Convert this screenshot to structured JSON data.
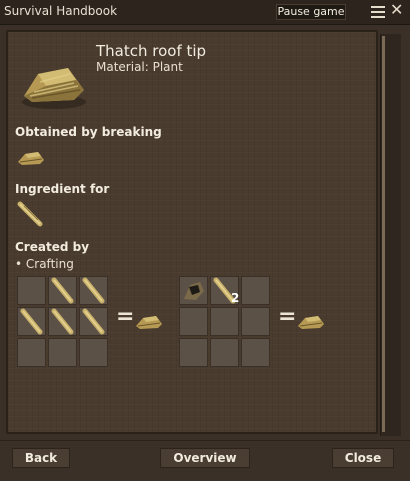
{
  "window": {
    "title": "Survival Handbook",
    "pause_label": "Pause game"
  },
  "item": {
    "name": "Thatch roof tip",
    "material": "Material: Plant",
    "icon": "thatch-roof-tip-icon"
  },
  "sections": {
    "obtained": "Obtained by breaking",
    "ingredient": "Ingredient for",
    "created": "Created by",
    "crafting": "• Crafting"
  },
  "recipes": [
    {
      "grid": [
        "",
        "straw",
        "straw",
        "straw",
        "straw",
        "straw",
        "",
        "",
        ""
      ],
      "output": "thatch-roof-tip-icon"
    },
    {
      "grid": [
        "dark-item",
        "straw",
        "",
        "",
        "",
        "",
        "",
        "",
        ""
      ],
      "quantity": "2",
      "output": "thatch-roof-tip-icon"
    }
  ],
  "buttons": {
    "back": "Back",
    "overview": "Overview",
    "close": "Close"
  },
  "icons": {
    "menu": "hamburger-menu-icon",
    "close": "close-icon"
  }
}
